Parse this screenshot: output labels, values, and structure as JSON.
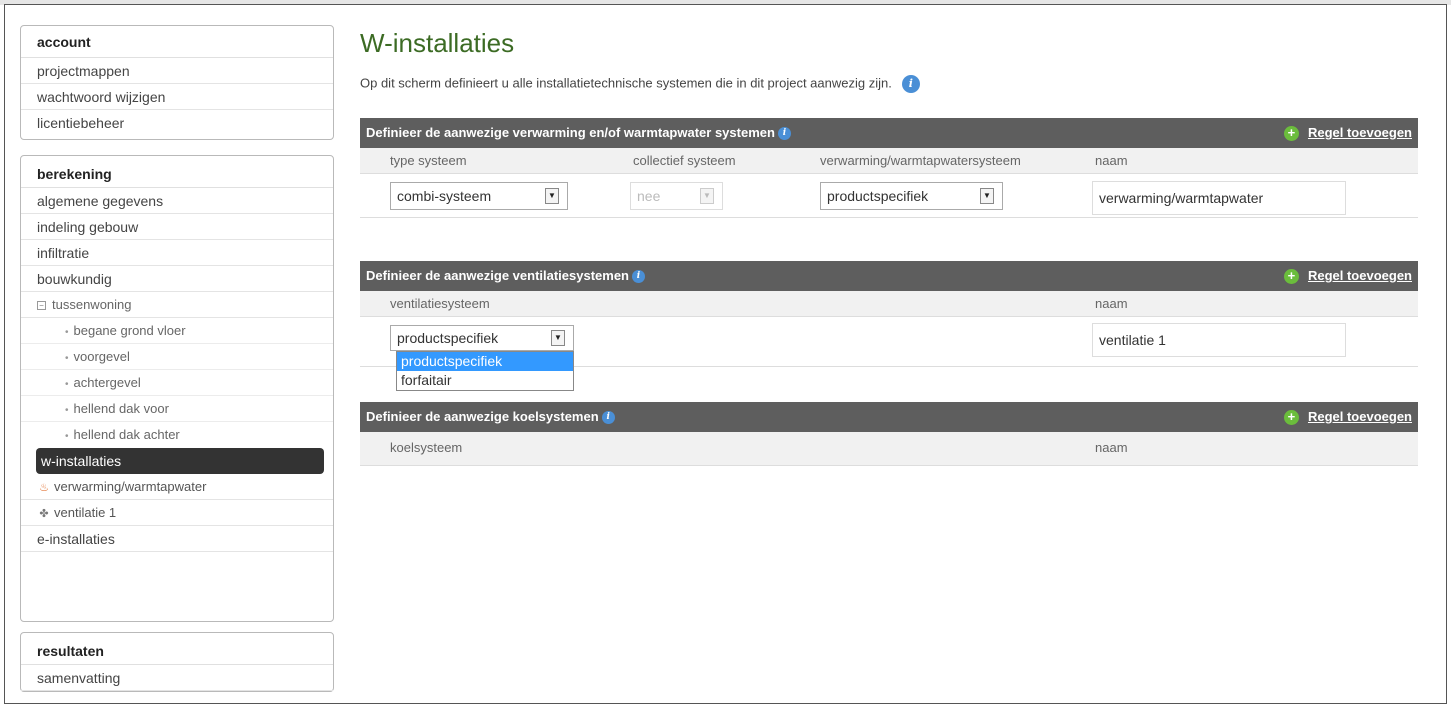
{
  "sidebar": {
    "account": {
      "title": "account",
      "items": [
        "projectmappen",
        "wachtwoord wijzigen",
        "licentiebeheer"
      ]
    },
    "berekening": {
      "title": "berekening",
      "items": [
        "algemene gegevens",
        "indeling gebouw",
        "infiltratie",
        "bouwkundig"
      ],
      "tree_root": "tussenwoning",
      "tree_children": [
        "begane grond vloer",
        "voorgevel",
        "achtergevel",
        "hellend dak voor",
        "hellend dak achter"
      ],
      "active": "w-installaties",
      "nested": [
        "verwarming/warmtapwater",
        "ventilatie 1"
      ],
      "after": "e-installaties"
    },
    "resultaten": {
      "title": "resultaten",
      "items": [
        "samenvatting"
      ]
    }
  },
  "main": {
    "title": "W-installaties",
    "intro": "Op dit scherm definieert u alle installatietechnische systemen die in dit project aanwezig zijn.",
    "info_symbol": "i",
    "add_symbol": "+",
    "dropdown_arrow": "▼",
    "heating": {
      "header": "Definieer de aanwezige verwarming en/of warmtapwater systemen",
      "add_label": "Regel toevoegen",
      "columns": [
        "type systeem",
        "collectief systeem",
        "verwarming/warmtapwatersysteem",
        "naam"
      ],
      "row": {
        "type": "combi-systeem",
        "collectief": "nee",
        "systeem": "productspecifiek",
        "naam": "verwarming/warmtapwater"
      }
    },
    "ventilation": {
      "header": "Definieer de aanwezige ventilatiesystemen",
      "add_label": "Regel toevoegen",
      "columns": [
        "ventilatiesysteem",
        "naam"
      ],
      "row": {
        "systeem": "productspecifiek",
        "naam": "ventilatie 1"
      },
      "dropdown_options": [
        "productspecifiek",
        "forfaitair"
      ]
    },
    "cooling": {
      "header": "Definieer de aanwezige koelsystemen",
      "add_label": "Regel toevoegen",
      "columns": [
        "koelsysteem",
        "naam"
      ]
    }
  },
  "colors": {
    "title_green": "#3c6b24",
    "bar_gray": "#5e5e5e",
    "active_item": "#333333",
    "info_blue": "#4a8fd6",
    "plus_green": "#6bbd3c",
    "select_highlight": "#3399ff"
  }
}
